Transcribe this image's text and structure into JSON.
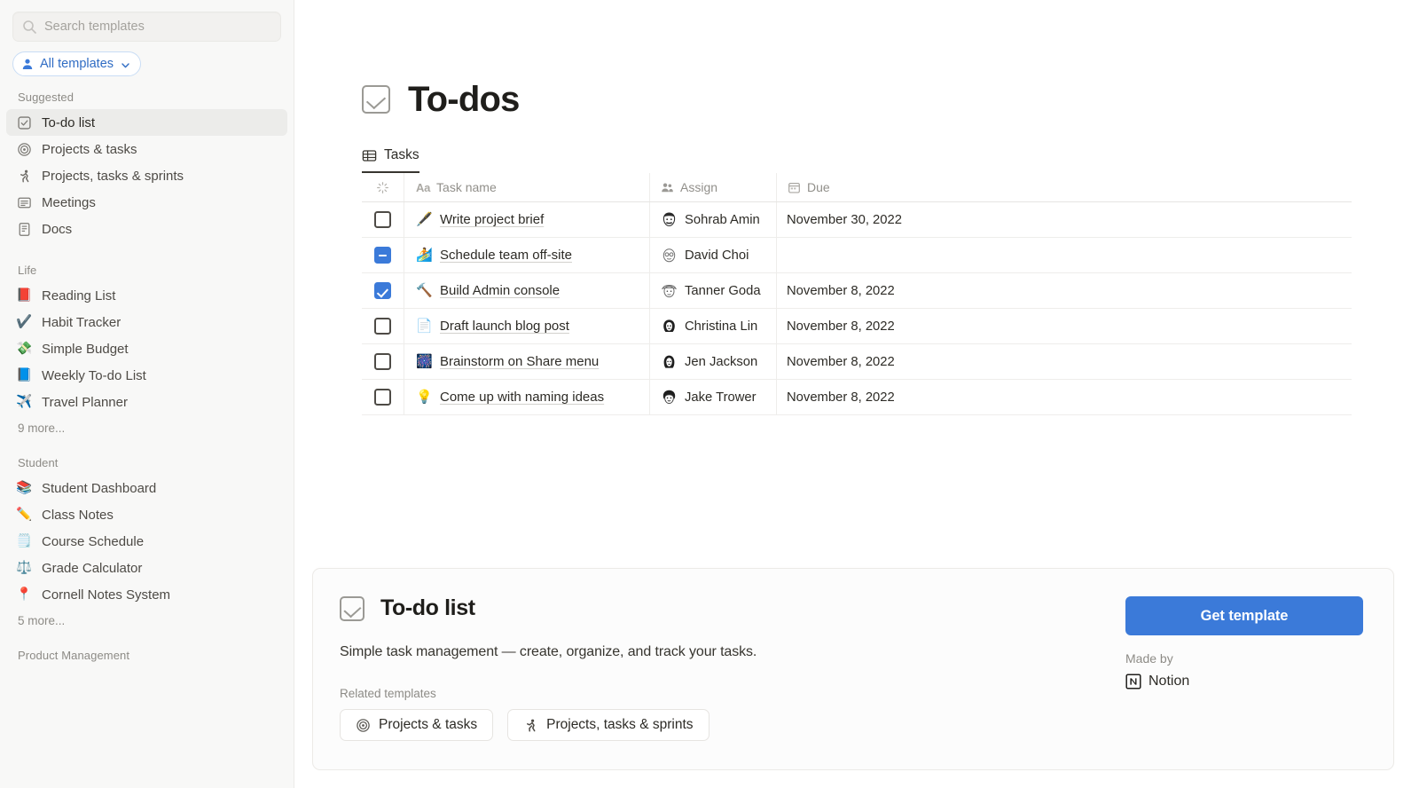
{
  "colors": {
    "accent_blue": "#3b7ad9",
    "pill_blue_text": "#2f6cc4",
    "sidebar_bg": "#f8f8f7",
    "sidebar_active_bg": "#ececea",
    "card_bg": "#fcfcfc",
    "text_primary": "#2d2b26",
    "text_muted": "#8d8b86"
  },
  "sidebar": {
    "search": {
      "placeholder": "Search templates",
      "value": "",
      "icon": "search-icon"
    },
    "filter_pill": {
      "label": "All templates",
      "person_icon": "person-icon",
      "chevron_icon": "chevron-down-icon"
    },
    "groups": [
      {
        "label": "Suggested",
        "items": [
          {
            "label": "To-do list",
            "icon": "checkbox-icon",
            "emoji": "",
            "active": true
          },
          {
            "label": "Projects & tasks",
            "icon": "target-icon",
            "emoji": "",
            "active": false
          },
          {
            "label": "Projects, tasks & sprints",
            "icon": "runner-icon",
            "emoji": "🏃",
            "active": false
          },
          {
            "label": "Meetings",
            "icon": "list-card-icon",
            "emoji": "",
            "active": false
          },
          {
            "label": "Docs",
            "icon": "document-icon",
            "emoji": "",
            "active": false
          }
        ],
        "more": ""
      },
      {
        "label": "Life",
        "items": [
          {
            "label": "Reading List",
            "icon": "closed-book-icon",
            "emoji": "📕",
            "active": false
          },
          {
            "label": "Habit Tracker",
            "icon": "check-mark-button-icon",
            "emoji": "✔️",
            "active": false
          },
          {
            "label": "Simple Budget",
            "icon": "money-with-wings-icon",
            "emoji": "💸",
            "active": false
          },
          {
            "label": "Weekly To-do List",
            "icon": "blue-book-icon",
            "emoji": "📘",
            "active": false
          },
          {
            "label": "Travel Planner",
            "icon": "airplane-icon",
            "emoji": "✈️",
            "active": false
          }
        ],
        "more": "9 more..."
      },
      {
        "label": "Student",
        "items": [
          {
            "label": "Student Dashboard",
            "icon": "books-icon",
            "emoji": "📚",
            "active": false
          },
          {
            "label": "Class Notes",
            "icon": "pencil-icon",
            "emoji": "✏️",
            "active": false
          },
          {
            "label": "Course Schedule",
            "icon": "spiral-notepad-icon",
            "emoji": "🗒️",
            "active": false
          },
          {
            "label": "Grade Calculator",
            "icon": "balance-scale-icon",
            "emoji": "⚖️",
            "active": false
          },
          {
            "label": "Cornell Notes System",
            "icon": "round-pushpin-icon",
            "emoji": "📍",
            "active": false
          }
        ],
        "more": "5 more..."
      },
      {
        "label": "Product Management",
        "items": [],
        "more": ""
      }
    ]
  },
  "preview": {
    "page_title": "To-dos",
    "page_icon": "checkbox-icon",
    "tabs": [
      {
        "label": "Tasks",
        "icon": "table-icon",
        "active": true
      }
    ],
    "table": {
      "columns": [
        {
          "label": "",
          "icon": "loading-spinner-icon",
          "type": "checkbox"
        },
        {
          "label": "Task name",
          "icon": "aa-text-icon",
          "type": "title"
        },
        {
          "label": "Assign",
          "icon": "people-icon",
          "type": "person"
        },
        {
          "label": "Due",
          "icon": "calendar-icon",
          "type": "date"
        }
      ],
      "rows": [
        {
          "checked": "unchecked",
          "emoji": "🖋️",
          "emoji_name": "fountain-pen-icon",
          "name": "Write project brief",
          "assignee": "Sohrab Amin",
          "avatar": "avatar-beard",
          "due": "November 30, 2022"
        },
        {
          "checked": "indeterminate",
          "emoji": "🏄",
          "emoji_name": "surfer-icon",
          "name": "Schedule team off-site",
          "assignee": "David Choi",
          "avatar": "avatar-glasses",
          "due": ""
        },
        {
          "checked": "checked",
          "emoji": "🔨",
          "emoji_name": "hammer-icon",
          "name": "Build Admin console",
          "assignee": "Tanner Goda",
          "avatar": "avatar-hat",
          "due": "November 8, 2022"
        },
        {
          "checked": "unchecked",
          "emoji": "📄",
          "emoji_name": "page-facing-up-icon",
          "name": "Draft launch blog post",
          "assignee": "Christina Lin",
          "avatar": "avatar-long-hair",
          "due": "November 8, 2022"
        },
        {
          "checked": "unchecked",
          "emoji": "🎆",
          "emoji_name": "fireworks-icon",
          "name": "Brainstorm on Share menu",
          "assignee": "Jen Jackson",
          "avatar": "avatar-bob-hair",
          "due": "November 8, 2022"
        },
        {
          "checked": "unchecked",
          "emoji": "💡",
          "emoji_name": "light-bulb-icon",
          "name": "Come up with naming ideas",
          "assignee": "Jake Trower",
          "avatar": "avatar-curly",
          "due": "November 8, 2022"
        }
      ]
    }
  },
  "footer": {
    "template_title": "To-do list",
    "template_icon": "checkbox-icon",
    "description": "Simple task management — create, organize, and track your tasks.",
    "related_label": "Related templates",
    "related": [
      {
        "label": "Projects & tasks",
        "icon": "target-icon"
      },
      {
        "label": "Projects, tasks & sprints",
        "icon": "runner-icon"
      }
    ],
    "get_template_label": "Get template",
    "made_by_label": "Made by",
    "made_by_name": "Notion",
    "made_by_icon": "notion-logo-icon"
  }
}
